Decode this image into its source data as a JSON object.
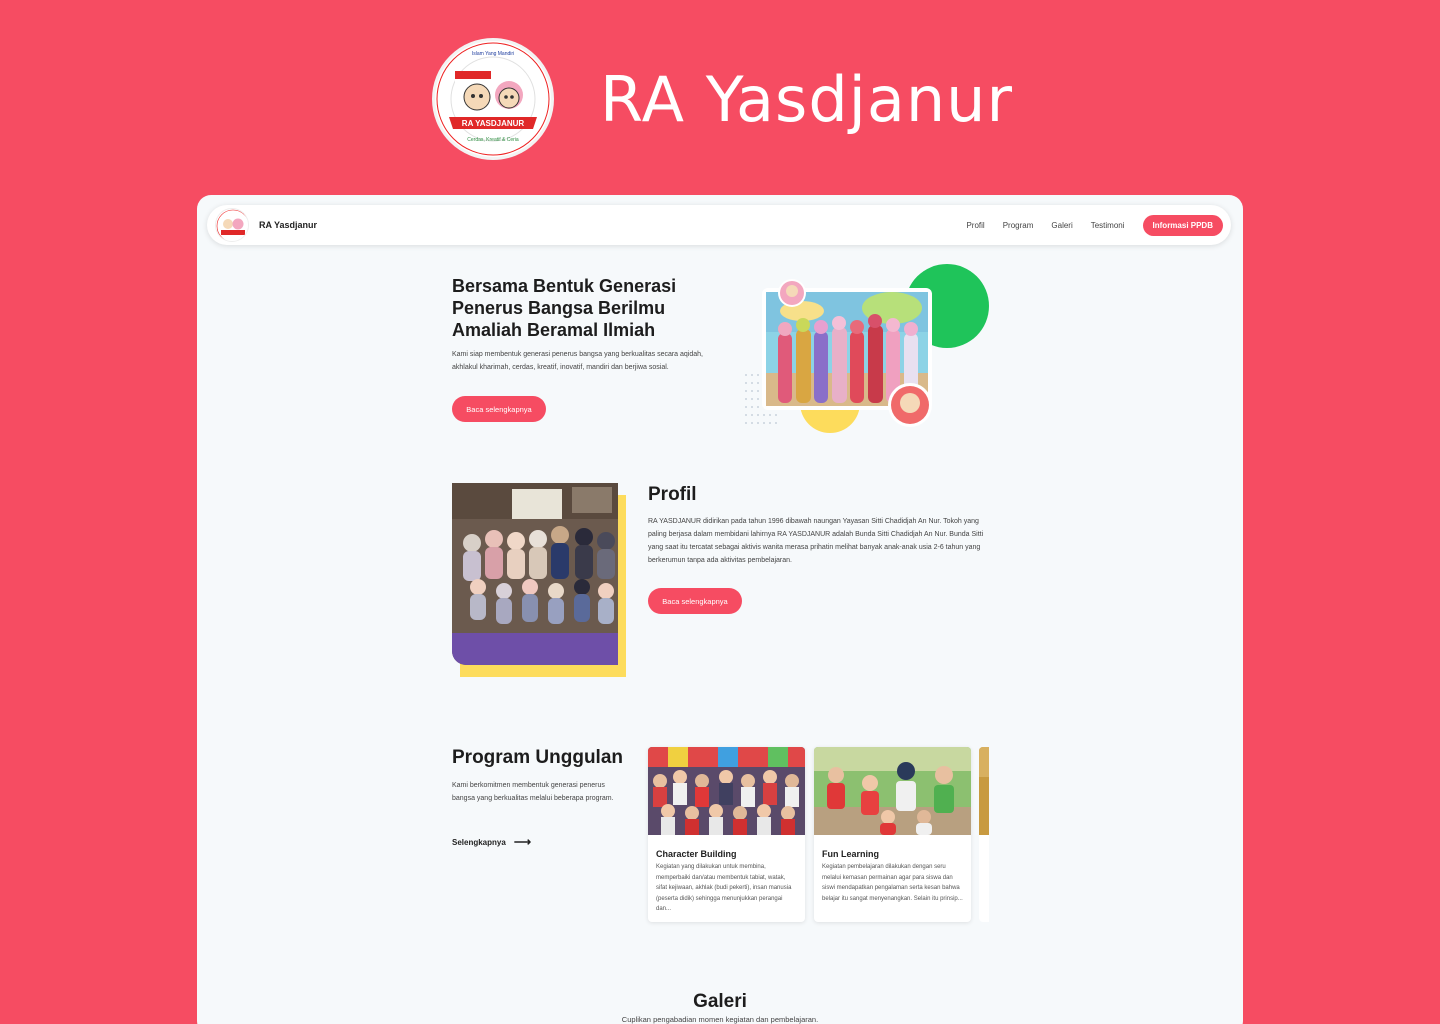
{
  "banner": {
    "title": "RA Yasdjanur",
    "logo_ring_top": "Menuju Generasi Islam Yang Mandiri & Akhlak Mulia",
    "logo_ribbon": "RA YASDJANUR",
    "logo_ring_bottom": "Cerdas, Kreatif & Ceria"
  },
  "nav": {
    "brand": "RA Yasdjanur",
    "links": [
      "Profil",
      "Program",
      "Galeri",
      "Testimoni"
    ],
    "cta": "Informasi PPDB"
  },
  "hero": {
    "heading": "Bersama Bentuk Generasi Penerus Bangsa Berilmu Amaliah Beramal Ilmiah",
    "text": "Kami siap membentuk generasi penerus bangsa yang berkualitas secara aqidah, akhlakul kharimah, cerdas, kreatif, inovatif, mandiri dan berjiwa sosial.",
    "button": "Baca selengkapnya"
  },
  "profil": {
    "heading": "Profil",
    "text": "RA YASDJANUR didirikan pada tahun 1996 dibawah naungan Yayasan Sitti Chadidjah An Nur. Tokoh yang paling berjasa dalam membidani lahirnya RA YASDJANUR adalah Bunda Sitti Chadidjah An Nur. Bunda Sitti yang saat itu tercatat sebagai aktivis wanita merasa prihatin melihat banyak anak-anak usia 2-6 tahun yang berkerumun tanpa ada aktivitas pembelajaran.",
    "button": "Baca selengkapnya"
  },
  "program": {
    "heading": "Program Unggulan",
    "text": "Kami berkomitmen membentuk generasi penerus bangsa yang berkualitas melalui beberapa program.",
    "link": "Selengkapnya",
    "cards": [
      {
        "title": "Character Building",
        "desc": "Kegiatan yang dilakukan untuk membina, memperbaiki dan/atau membentuk tabiat, watak, sifat kejiwaan, akhlak (budi pekerti), insan manusia (peserta didik) sehingga menunjukkan perangai dan..."
      },
      {
        "title": "Fun Learning",
        "desc": "Kegiatan pembelajaran dilakukan dengan seru melalui kemasan permainan agar para siswa dan siswi mendapatkan pengalaman serta kesan bahwa belajar itu sangat menyenangkan. Selain itu prinsip..."
      }
    ]
  },
  "galeri": {
    "heading": "Galeri",
    "subtitle": "Cuplikan pengabadian momen kegiatan dan pembelajaran."
  },
  "colors": {
    "accent": "#f64c62",
    "green": "#1fc45a",
    "yellow": "#fddc5c"
  }
}
